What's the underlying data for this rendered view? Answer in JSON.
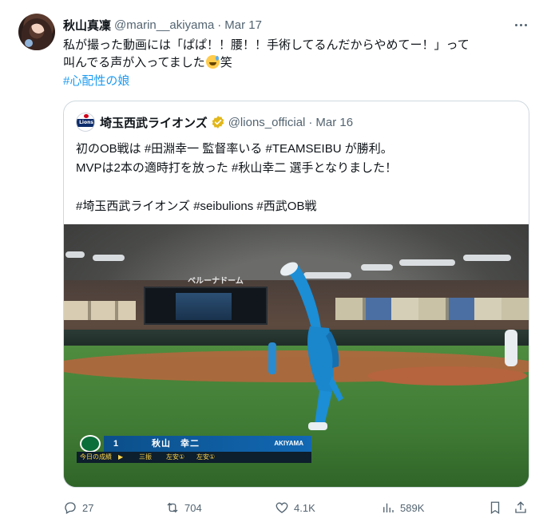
{
  "tweet": {
    "author_name": "秋山真凜",
    "author_handle": "@marin__akiyama",
    "separator": "·",
    "date": "Mar 17",
    "text_line1": "私が撮った動画には「ぱぱ！！腰！！手術してるんだからやめてー！」って",
    "text_line2_pre": "叫んでる声が入ってました",
    "emoji": "sweat-smile-emoji",
    "text_line2_post": "笑",
    "hashtag": "#心配性の娘"
  },
  "quote": {
    "author_name": "埼玉西武ライオンズ",
    "author_handle": "@lions_official",
    "separator": "·",
    "date": "Mar 16",
    "logo_text": "Lions",
    "line1": "初のOB戦は #田淵幸一 監督率いる #TEAMSEIBU が勝利。",
    "line2": "MVPは2本の適時打を放った #秋山幸二 選手となりました！",
    "line3": "",
    "line4": "#埼玉西武ライオンズ #seibulions #西武OB戦"
  },
  "media": {
    "scoreboard_text": "ベルーナドーム",
    "overlay": {
      "number": "1",
      "player_name": "秋山　幸二",
      "romaji": "AKIYAMA",
      "today_label": "今日の成績",
      "arrow": "▶",
      "ab1": "三振",
      "ab2": "左安①",
      "ab3": "左安①"
    }
  },
  "actions": {
    "replies": "27",
    "reposts": "704",
    "likes": "4.1K",
    "views": "589K"
  },
  "colors": {
    "link": "#1d9bf0",
    "secondary_text": "#536471",
    "border": "#cfd9de",
    "verified_badge": "#e2b719"
  }
}
